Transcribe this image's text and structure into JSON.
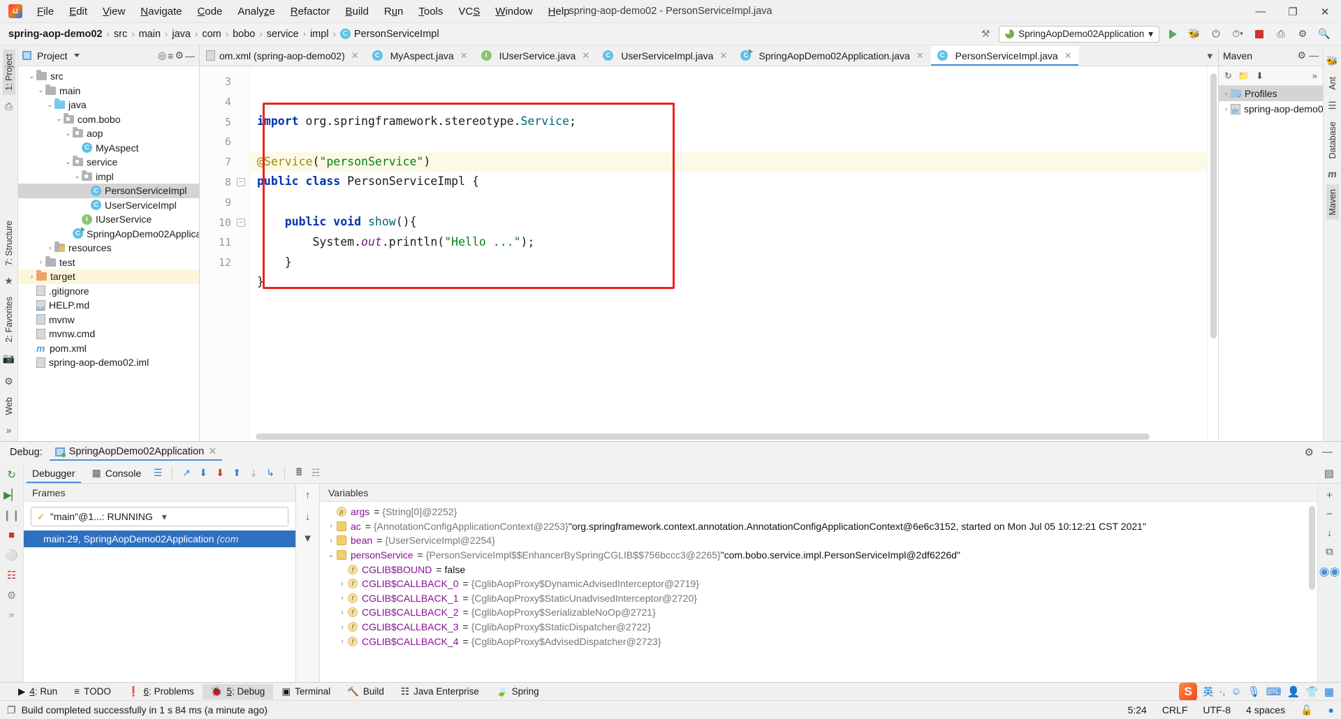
{
  "titlebar": {
    "window_title": "spring-aop-demo02 - PersonServiceImpl.java",
    "menus": [
      "File",
      "Edit",
      "View",
      "Navigate",
      "Code",
      "Analyze",
      "Refactor",
      "Build",
      "Run",
      "Tools",
      "VCS",
      "Window",
      "Help"
    ],
    "minimize": "—",
    "maximize": "❐",
    "close": "✕"
  },
  "navbar": {
    "crumbs": [
      "spring-aop-demo02",
      "src",
      "main",
      "java",
      "com",
      "bobo",
      "service",
      "impl"
    ],
    "file_crumb": "PersonServiceImpl",
    "file_crumb_icon": "C",
    "run_config": "SpringAopDemo02Application",
    "run_config_caret": "▾",
    "buttons": {
      "hammer": "⚒",
      "run": "run-triangle",
      "debug": "🐞",
      "run_coverage": "⟳",
      "profile": "⏱",
      "stop": "stop-square",
      "settings": "⚙",
      "updates": "⭳",
      "search": "🔍"
    }
  },
  "left_rail": {
    "project_label": "1: Project",
    "structure_label": "7: Structure",
    "favorites_label": "2: Favorites",
    "web_label": "Web",
    "more": "»"
  },
  "right_rail": {
    "ant_label": "Ant",
    "database_label": "Database",
    "maven_label": "Maven"
  },
  "project_panel": {
    "title": "Project",
    "caret": "▾",
    "tools": [
      "⊕",
      "≡",
      "⚙",
      "—"
    ],
    "tree": [
      {
        "indent": 2,
        "arrow": "⌄",
        "icon": "folder",
        "label": "src",
        "state": ""
      },
      {
        "indent": 3,
        "arrow": "⌄",
        "icon": "folder",
        "label": "main",
        "state": ""
      },
      {
        "indent": 4,
        "arrow": "⌄",
        "icon": "folder-blue",
        "label": "java",
        "state": ""
      },
      {
        "indent": 5,
        "arrow": "⌄",
        "icon": "folder-pkg",
        "label": "com.bobo",
        "state": ""
      },
      {
        "indent": 6,
        "arrow": "⌄",
        "icon": "folder-pkg",
        "label": "aop",
        "state": ""
      },
      {
        "indent": 7,
        "arrow": "",
        "icon": "class",
        "label": "MyAspect",
        "state": ""
      },
      {
        "indent": 6,
        "arrow": "⌄",
        "icon": "folder-pkg",
        "label": "service",
        "state": ""
      },
      {
        "indent": 7,
        "arrow": "⌄",
        "icon": "folder-pkg",
        "label": "impl",
        "state": ""
      },
      {
        "indent": 8,
        "arrow": "",
        "icon": "class",
        "label": "PersonServiceImpl",
        "state": "selected"
      },
      {
        "indent": 8,
        "arrow": "",
        "icon": "class",
        "label": "UserServiceImpl",
        "state": ""
      },
      {
        "indent": 7,
        "arrow": "",
        "icon": "interface",
        "label": "IUserService",
        "state": ""
      },
      {
        "indent": 6,
        "arrow": "",
        "icon": "class-run",
        "label": "SpringAopDemo02Application",
        "state": ""
      },
      {
        "indent": 4,
        "arrow": "›",
        "icon": "folder-res",
        "label": "resources",
        "state": ""
      },
      {
        "indent": 3,
        "arrow": "›",
        "icon": "folder",
        "label": "test",
        "state": ""
      },
      {
        "indent": 2,
        "arrow": "›",
        "icon": "folder-orange",
        "label": "target",
        "state": "highlight"
      },
      {
        "indent": 2,
        "arrow": "",
        "icon": "file",
        "label": ".gitignore",
        "state": ""
      },
      {
        "indent": 2,
        "arrow": "",
        "icon": "file-md",
        "label": "HELP.md",
        "state": ""
      },
      {
        "indent": 2,
        "arrow": "",
        "icon": "file-sh",
        "label": "mvnw",
        "state": ""
      },
      {
        "indent": 2,
        "arrow": "",
        "icon": "file",
        "label": "mvnw.cmd",
        "state": ""
      },
      {
        "indent": 2,
        "arrow": "",
        "icon": "maven",
        "label": "pom.xml",
        "state": ""
      },
      {
        "indent": 2,
        "arrow": "",
        "icon": "file",
        "label": "spring-aop-demo02.iml",
        "state": ""
      }
    ]
  },
  "editor": {
    "tabs": [
      {
        "label": "om.xml (spring-aop-demo02)",
        "icon": "xml",
        "active": false,
        "close": "✕"
      },
      {
        "label": "MyAspect.java",
        "icon": "class",
        "active": false,
        "close": "✕"
      },
      {
        "label": "IUserService.java",
        "icon": "interface",
        "active": false,
        "close": "✕"
      },
      {
        "label": "UserServiceImpl.java",
        "icon": "class",
        "active": false,
        "close": "✕"
      },
      {
        "label": "SpringAopDemo02Application.java",
        "icon": "class-run",
        "active": false,
        "close": "✕"
      },
      {
        "label": "PersonServiceImpl.java",
        "icon": "class",
        "active": true,
        "close": "✕"
      }
    ],
    "tab_more": "▾",
    "line_numbers": [
      "3",
      "4",
      "5",
      "6",
      "7",
      "8",
      "9",
      "10",
      "11",
      "12"
    ],
    "code_lines": [
      {
        "n": 3,
        "html": "<span class=\"kw\">import</span> org.springframework.stereotype.<span class=\"mth\">Service</span>;"
      },
      {
        "n": 4,
        "html": ""
      },
      {
        "n": 5,
        "html": "<span class=\"ann\">@Service</span>(<span class=\"str\">\"personService\"</span>)",
        "highlight": true
      },
      {
        "n": 6,
        "html": "<span class=\"kw\">public</span> <span class=\"kw\">class</span> PersonServiceImpl {"
      },
      {
        "n": 7,
        "html": ""
      },
      {
        "n": 8,
        "html": "    <span class=\"kw\">public</span> <span class=\"kw\">void</span> <span class=\"mth\">show</span>(){"
      },
      {
        "n": 9,
        "html": "        System.<span class=\"fld\">out</span>.println(<span class=\"str\">\"Hello ...\"</span>);"
      },
      {
        "n": 10,
        "html": "    }"
      },
      {
        "n": 11,
        "html": "}"
      },
      {
        "n": 12,
        "html": ""
      }
    ],
    "inspection_ok": "✓"
  },
  "maven_panel": {
    "title": "Maven",
    "gear": "⚙",
    "collapse": "—",
    "tools": [
      "↻",
      "📁",
      "⬇",
      "»"
    ],
    "rows": [
      {
        "arrow": "›",
        "icon": "profiles",
        "label": "Profiles",
        "state": "selected"
      },
      {
        "arrow": "›",
        "icon": "project",
        "label": "spring-aop-demo02",
        "state": ""
      }
    ]
  },
  "debug": {
    "panel_label": "Debug:",
    "session_name": "SpringAopDemo02Application",
    "session_close": "✕",
    "settings_icon": "⚙",
    "minimize_icon": "—",
    "tabs": [
      {
        "label": "Debugger",
        "active": true
      },
      {
        "label": "Console",
        "active": false
      }
    ],
    "toolbar_icons": [
      "≡",
      "⤴",
      "⬇",
      "⬇",
      "⬆",
      "⤵",
      "↳",
      "▦",
      "≔"
    ],
    "left_rail_icons": [
      "↺",
      "▶❘",
      "❘❘",
      "■",
      "⊘",
      "≡",
      "▣"
    ],
    "frames": {
      "header": "Frames",
      "thread_label": "\"main\"@1...: RUNNING",
      "thread_check": "✓",
      "dropdown_caret": "▾",
      "controls": [
        "↑",
        "↓",
        "✇"
      ],
      "rows": [
        {
          "label": "main:29, SpringAopDemo02Application ",
          "italic": "(com"
        }
      ]
    },
    "variables": {
      "header": "Variables",
      "add_icon": "+",
      "remove_icon": "−",
      "down_icon": "↓",
      "copy_icon": "⧉",
      "glasses_icon": "∞",
      "rows": [
        {
          "indent": 0,
          "arrow": "",
          "icon": "p",
          "name": "args",
          "eq": "=",
          "value": "{String[0]@2252}",
          "str": ""
        },
        {
          "indent": 0,
          "arrow": "›",
          "icon": "obj",
          "name": "ac",
          "eq": "=",
          "value": "{AnnotationConfigApplicationContext@2253}",
          "str": "\"org.springframework.context.annotation.AnnotationConfigApplicationContext@6e6c3152, started on Mon Jul 05 10:12:21 CST 2021\""
        },
        {
          "indent": 0,
          "arrow": "›",
          "icon": "obj",
          "name": "bean",
          "eq": "=",
          "value": "{UserServiceImpl@2254}",
          "str": ""
        },
        {
          "indent": 0,
          "arrow": "⌄",
          "icon": "obj",
          "name": "personService",
          "eq": "=",
          "value": "{PersonServiceImpl$$EnhancerBySpringCGLIB$$756bccc3@2265}",
          "str": "\"com.bobo.service.impl.PersonServiceImpl@2df6226d\""
        },
        {
          "indent": 1,
          "arrow": "",
          "icon": "f",
          "name": "CGLIB$BOUND",
          "eq": "=",
          "value": "false",
          "str": "",
          "plain": true
        },
        {
          "indent": 1,
          "arrow": "›",
          "icon": "f",
          "name": "CGLIB$CALLBACK_0",
          "eq": "=",
          "value": "{CglibAopProxy$DynamicAdvisedInterceptor@2719}",
          "str": ""
        },
        {
          "indent": 1,
          "arrow": "›",
          "icon": "f",
          "name": "CGLIB$CALLBACK_1",
          "eq": "=",
          "value": "{CglibAopProxy$StaticUnadvisedInterceptor@2720}",
          "str": ""
        },
        {
          "indent": 1,
          "arrow": "›",
          "icon": "f",
          "name": "CGLIB$CALLBACK_2",
          "eq": "=",
          "value": "{CglibAopProxy$SerializableNoOp@2721}",
          "str": ""
        },
        {
          "indent": 1,
          "arrow": "›",
          "icon": "f",
          "name": "CGLIB$CALLBACK_3",
          "eq": "=",
          "value": "{CglibAopProxy$StaticDispatcher@2722}",
          "str": ""
        },
        {
          "indent": 1,
          "arrow": "›",
          "icon": "f",
          "name": "CGLIB$CALLBACK_4",
          "eq": "=",
          "value": "{CglibAopProxy$AdvisedDispatcher@2723}",
          "str": ""
        }
      ]
    }
  },
  "toolwindow_bar": {
    "items": [
      {
        "icon": "▶",
        "label": "4: Run",
        "active": false
      },
      {
        "icon": "≡",
        "label": "TODO",
        "active": false
      },
      {
        "icon": "❗",
        "label": "6: Problems",
        "active": false
      },
      {
        "icon": "🐞",
        "label": "5: Debug",
        "active": true
      },
      {
        "icon": "▣",
        "label": "Terminal",
        "active": false
      },
      {
        "icon": "🔨",
        "label": "Build",
        "active": false
      },
      {
        "icon": "☷",
        "label": "Java Enterprise",
        "active": false
      },
      {
        "icon": "🍃",
        "label": "Spring",
        "active": false
      }
    ],
    "tray": [
      "S",
      "英",
      "·,",
      "☺",
      "🎙",
      "⌨",
      "👤",
      "👕",
      "▒"
    ]
  },
  "statusbar": {
    "icon": "❐",
    "message": "Build completed successfully in 1 s 84 ms (a minute ago)",
    "caret_position": "5:24",
    "line_separator": "CRLF",
    "encoding": "UTF-8",
    "indent": "4 spaces",
    "lock_icon": "🔓"
  },
  "colors": {
    "accent": "#4a90d9",
    "highlight_box": "#f01f1f",
    "selection": "#2e6fc0",
    "keyword": "#0033b3",
    "string": "#067d17",
    "annotation": "#9e880d"
  }
}
